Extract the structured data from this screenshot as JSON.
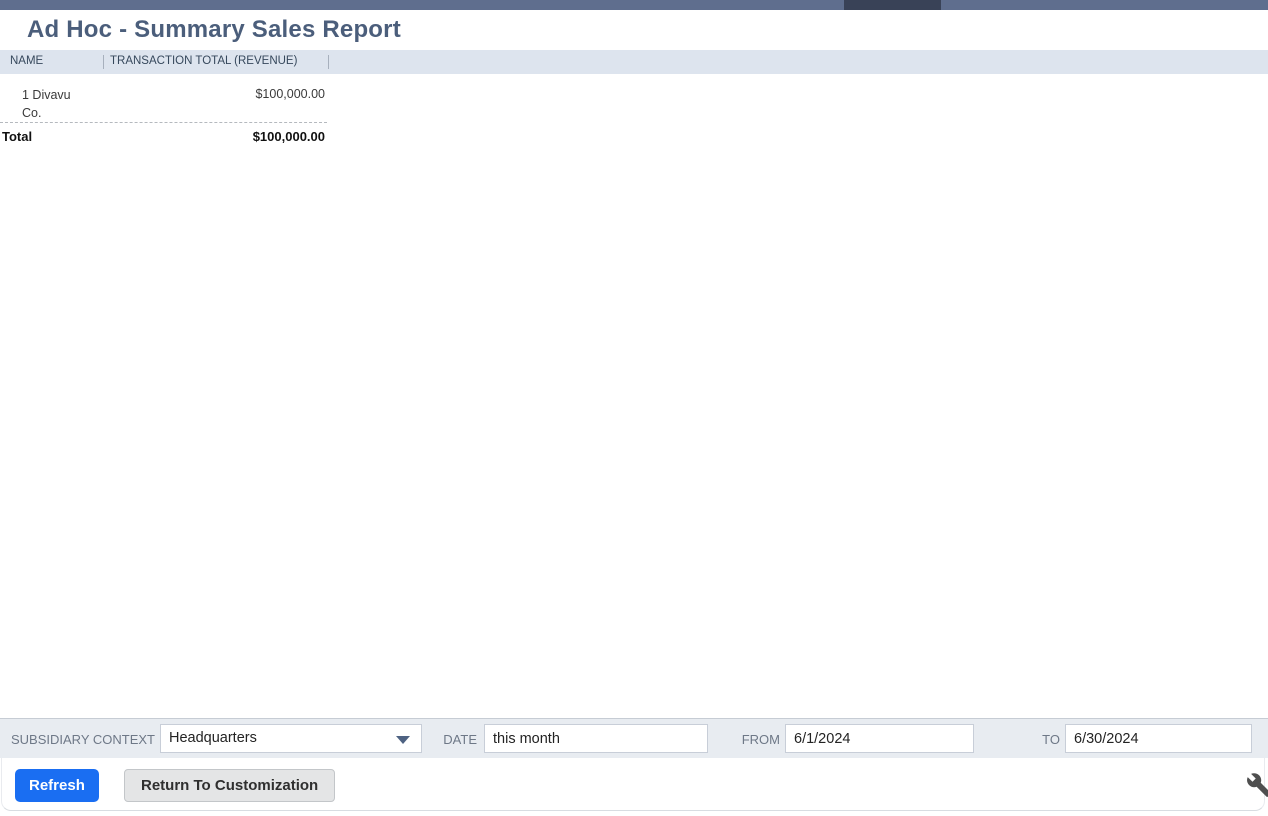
{
  "colors": {
    "topbar": "#5f6e8e",
    "topbar_active": "#394257",
    "title": "#4b5e7b",
    "table_header_bg": "#dde4ee",
    "accent_blue": "#1a6ef2"
  },
  "page": {
    "title": "Ad Hoc - Summary Sales Report"
  },
  "report_table": {
    "columns": [
      {
        "label": "NAME"
      },
      {
        "label": "TRANSACTION TOTAL (REVENUE)"
      }
    ],
    "rows": [
      {
        "name": "1 Divavu Co.",
        "value": "$100,000.00"
      }
    ],
    "total_label": "Total",
    "total_value": "$100,000.00"
  },
  "filters": {
    "subsidiary_context": {
      "label": "SUBSIDIARY CONTEXT",
      "value": "Headquarters"
    },
    "date": {
      "label": "DATE",
      "value": "this month"
    },
    "from": {
      "label": "FROM",
      "value": "6/1/2024"
    },
    "to": {
      "label": "TO",
      "value": "6/30/2024"
    }
  },
  "actions": {
    "refresh": "Refresh",
    "return_to_customization": "Return To Customization"
  },
  "icons": {
    "dropdown_caret": "caret-down-icon",
    "settings": "wrench-icon"
  }
}
